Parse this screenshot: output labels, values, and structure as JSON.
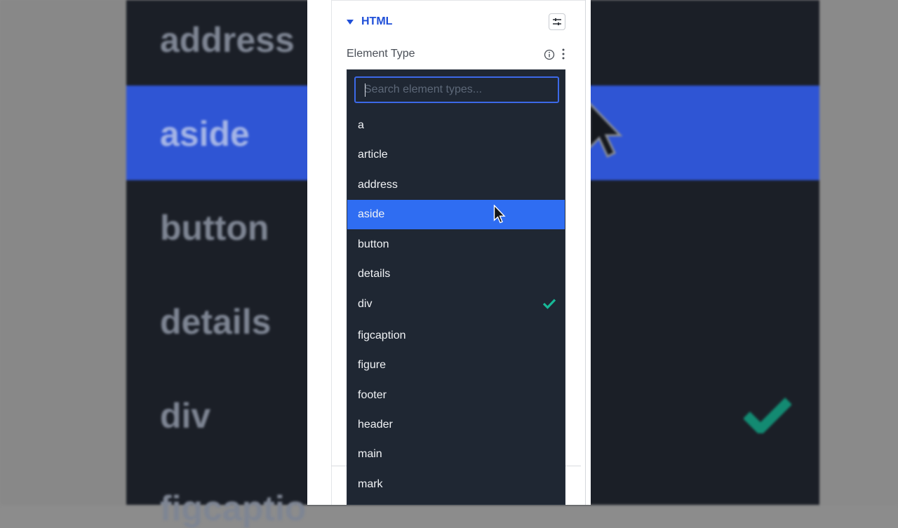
{
  "section": {
    "title": "HTML"
  },
  "field": {
    "label": "Element Type"
  },
  "search": {
    "placeholder": "Search element types..."
  },
  "options": [
    {
      "label": "a"
    },
    {
      "label": "article"
    },
    {
      "label": "address"
    },
    {
      "label": "aside",
      "highlighted": true
    },
    {
      "label": "button"
    },
    {
      "label": "details"
    },
    {
      "label": "div",
      "checked": true
    },
    {
      "label": "figcaption"
    },
    {
      "label": "figure"
    },
    {
      "label": "footer"
    },
    {
      "label": "header"
    },
    {
      "label": "main"
    },
    {
      "label": "mark"
    }
  ],
  "background_zoom": {
    "items": [
      "address",
      "aside",
      "button",
      "details",
      "div",
      "figcaptio"
    ]
  },
  "colors": {
    "accent": "#1f4fd8",
    "highlight": "#2f6df2",
    "check": "#17b897",
    "dropdown_bg": "#1f2733"
  }
}
